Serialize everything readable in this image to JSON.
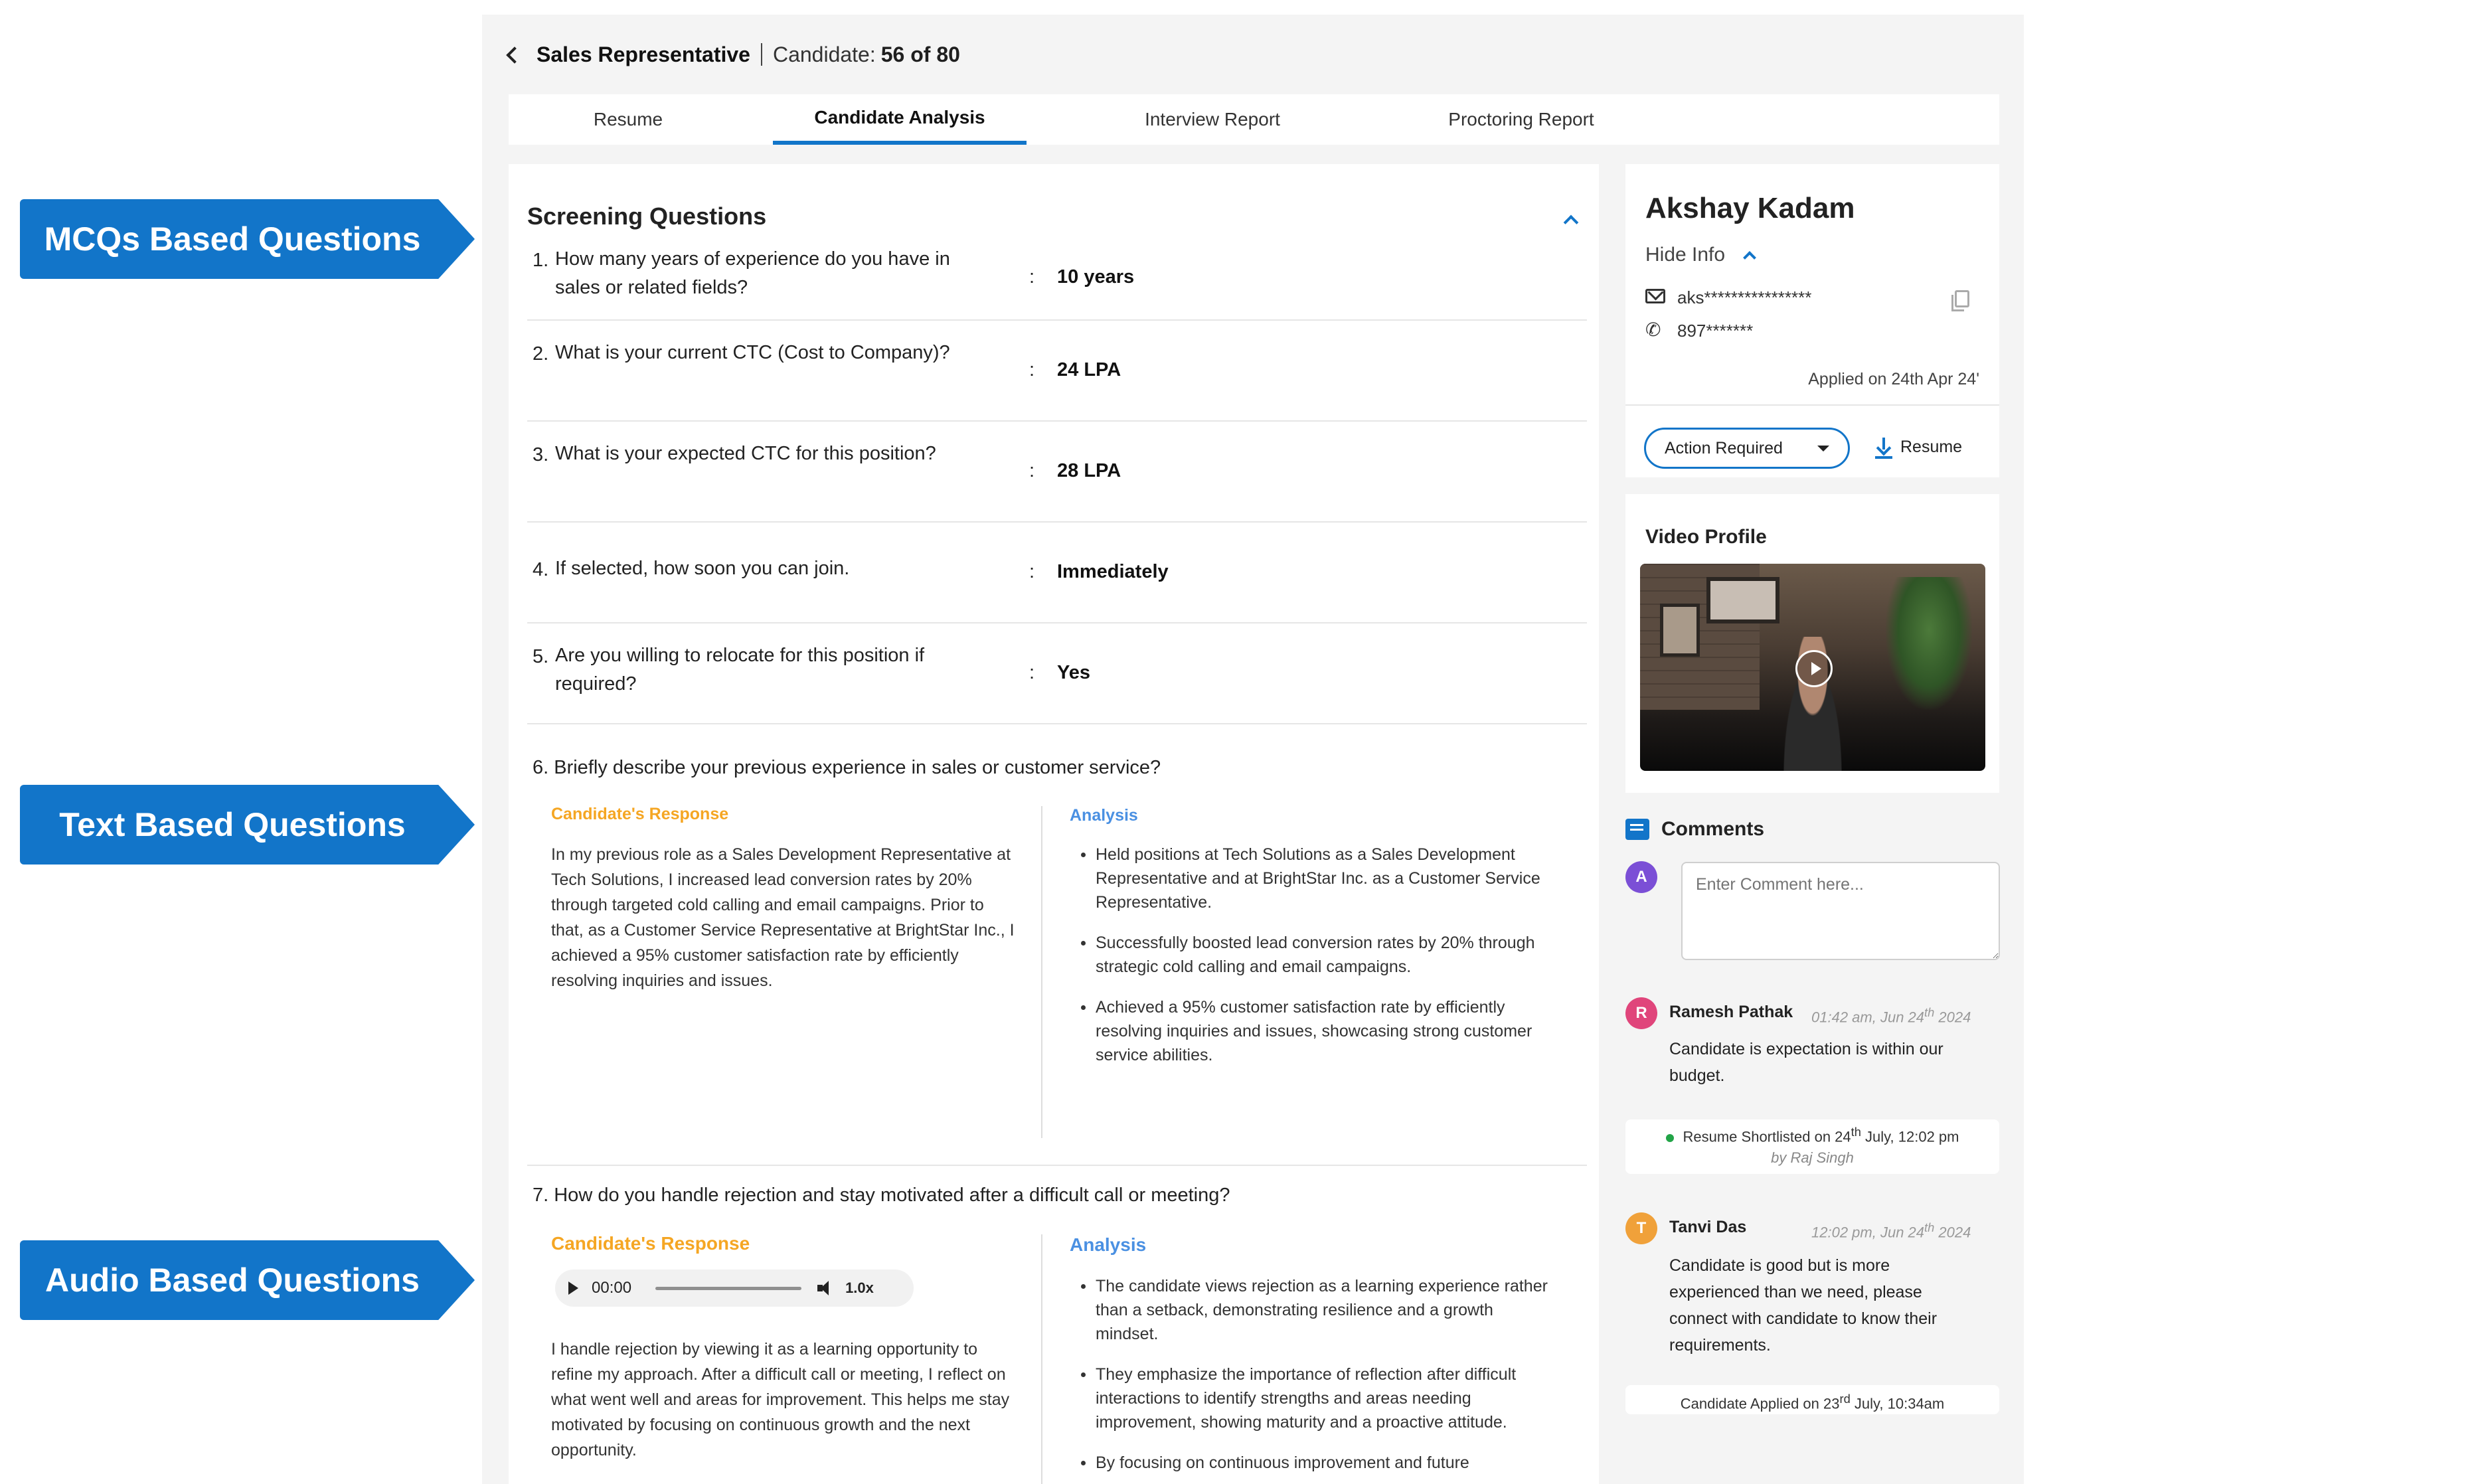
{
  "callouts": {
    "mcq": "MCQs Based Questions",
    "text": "Text Based Questions",
    "audio": "Audio Based Questions"
  },
  "header": {
    "title": "Sales Representative",
    "candidate_label": "Candidate:",
    "candidate_value": "56 of 80"
  },
  "tabs": [
    "Resume",
    "Candidate Analysis",
    "Interview Report",
    "Proctoring Report"
  ],
  "active_tab": "Candidate Analysis",
  "screening": {
    "title": "Screening Questions",
    "mcq": [
      {
        "num": "1.",
        "q": "How many years of experience do you have in sales or related fields?",
        "a": "10 years"
      },
      {
        "num": "2.",
        "q": "What is your current CTC (Cost to Company)?",
        "a": "24 LPA"
      },
      {
        "num": "3.",
        "q": "What is your expected CTC for  this position?",
        "a": "28 LPA"
      },
      {
        "num": "4.",
        "q": "If selected, how soon you can join.",
        "a": "Immediately"
      },
      {
        "num": "5.",
        "q": "Are you willing to relocate for this position if required?",
        "a": "Yes"
      }
    ],
    "text_q": {
      "q": "6. Briefly describe your previous experience in sales or customer service?",
      "response_label": "Candidate's  Response",
      "response": "In my previous role as a Sales Development Representative at Tech Solutions, I increased lead conversion rates by 20% through targeted cold calling and email campaigns. Prior to that, as a Customer Service Representative at BrightStar Inc., I achieved a 95% customer satisfaction rate by efficiently resolving inquiries and issues.",
      "analysis_label": "Analysis",
      "analysis": [
        "Held positions at Tech Solutions as a Sales Development Representative and at BrightStar Inc. as a Customer Service Representative.",
        "Successfully boosted lead conversion rates by 20% through strategic cold calling and email campaigns.",
        "Achieved a 95% customer satisfaction rate by efficiently resolving inquiries and issues, showcasing strong customer service abilities."
      ]
    },
    "audio_q": {
      "q": "7. How do you handle rejection and stay motivated after a difficult call or meeting?",
      "response_label": "Candidate's  Response",
      "player": {
        "time": "00:00",
        "speed": "1.0x",
        "progress": 0
      },
      "response": "I handle rejection by viewing it as a learning opportunity to refine my approach. After a difficult call or meeting, I reflect on what went well and areas for improvement. This helps me stay motivated by focusing on continuous growth and the next opportunity.",
      "analysis_label": "Analysis",
      "analysis": [
        "The candidate views rejection as a learning experience rather than a setback, demonstrating resilience and a growth mindset.",
        "They emphasize the importance of reflection after difficult interactions to identify strengths and areas needing improvement, showing maturity and a proactive attitude.",
        "By focusing on continuous improvement and future"
      ]
    }
  },
  "profile": {
    "name": "Akshay Kadam",
    "hide_info": "Hide Info",
    "email": "aks****************",
    "phone": "897*******",
    "applied": "Applied on 24th Apr 24'",
    "action_button": "Action Required",
    "resume_link": "Resume"
  },
  "video": {
    "title": "Video Profile"
  },
  "comments": {
    "title": "Comments",
    "my_avatar": "A",
    "placeholder": "Enter Comment here...",
    "items": [
      {
        "avatar": "R",
        "name": "Ramesh Pathak",
        "time_pre": "01:42 am, Jun 24",
        "time_sup": "th",
        "time_post": " 2024",
        "text": "Candidate is expectation is within our budget."
      },
      {
        "avatar": "T",
        "name": "Tanvi Das",
        "time_pre": "12:02 pm, Jun 24",
        "time_sup": "th",
        "time_post": " 2024",
        "text": "Candidate is good but is more experienced than we need, please connect with candidate to know their requirements."
      }
    ],
    "event1": {
      "pre": "Resume Shortlisted on 24",
      "sup": "th",
      "post": " July, 12:02 pm",
      "by": "by Raj Singh"
    },
    "event2": {
      "pre": "Candidate Applied on 23",
      "sup": "rd",
      "post": " July, 10:34am"
    }
  },
  "colors": {
    "accent": "#1275c9",
    "response": "#f5a623",
    "analysis": "#4a90e2",
    "status_dot": "#22a447"
  }
}
